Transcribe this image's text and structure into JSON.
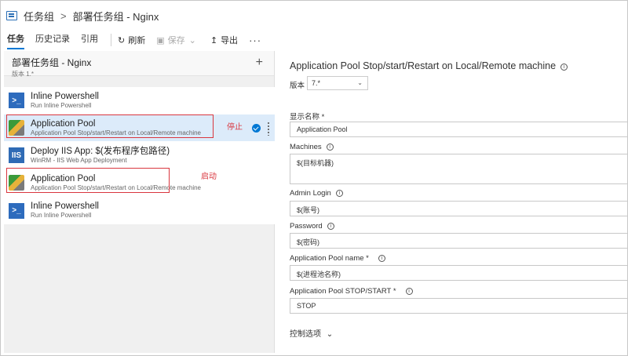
{
  "header": {
    "crumb1": "任务组",
    "crumb2": "部署任务组 - Nginx"
  },
  "toolbar": {
    "tabs": [
      "任务",
      "历史记录",
      "引用"
    ],
    "refresh": "刷新",
    "save": "保存",
    "export": "导出",
    "more": "···"
  },
  "left": {
    "title": "部署任务组 - Nginx",
    "version": "版本 1.*",
    "tasks": [
      {
        "name": "Inline Powershell",
        "sub": "Run Inline Powershell",
        "icon": ">_"
      },
      {
        "name": "Application Pool",
        "sub": "Application Pool Stop/start/Restart on Local/Remote machine"
      },
      {
        "name": "Deploy IIS App: $(发布程序包路径)",
        "sub": "WinRM - IIS Web App Deployment",
        "icon": "IIS"
      },
      {
        "name": "Application Pool",
        "sub": "Application Pool Stop/start/Restart on Local/Remote machine"
      },
      {
        "name": "Inline Powershell",
        "sub": "Run Inline Powershell",
        "icon": ">_"
      }
    ],
    "annotation_stop": "停止",
    "annotation_start": "启动"
  },
  "right": {
    "title": "Application Pool Stop/start/Restart on Local/Remote machine",
    "version_label": "版本",
    "version_value": "7.*",
    "display_name_label": "显示名称 *",
    "display_name_value": "Application Pool",
    "machines_label": "Machines",
    "machines_value": "$(目标机器)",
    "admin_login_label": "Admin Login",
    "admin_login_value": "$(账号)",
    "password_label": "Password",
    "password_value": "$(密码)",
    "pool_name_label": "Application Pool name *",
    "pool_name_value": "$(进程池名称)",
    "stop_start_label": "Application Pool STOP/START *",
    "stop_start_value": "STOP",
    "control_options": "控制选项"
  },
  "colors": {
    "accent": "#0078d4",
    "annotation_red": "#d9363e",
    "selected_row": "#dcebfa"
  }
}
